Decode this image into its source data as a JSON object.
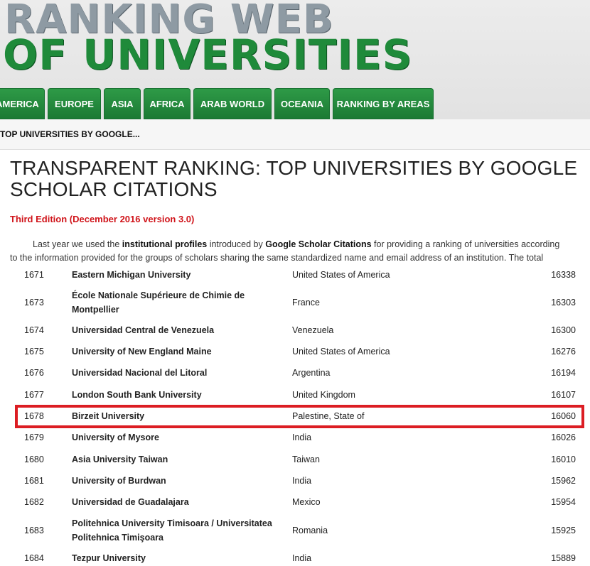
{
  "header": {
    "logo_line1": "RANKING WEB",
    "logo_line2": "OF UNIVERSITIES"
  },
  "nav": {
    "tabs": [
      {
        "label": "AMERICA"
      },
      {
        "label": "EUROPE"
      },
      {
        "label": "ASIA"
      },
      {
        "label": "AFRICA"
      },
      {
        "label": "ARAB WORLD"
      },
      {
        "label": "OCEANIA"
      },
      {
        "label": "RANKING BY AREAS"
      }
    ]
  },
  "breadcrumb": "TOP UNIVERSITIES BY GOOGLE...",
  "title": "TRANSPARENT RANKING: TOP UNIVERSITIES BY GOOGLE SCHOLAR CITATIONS",
  "edition": "Third Edition (December 2016 version 3.0)",
  "intro": {
    "p1": "Last year we used the ",
    "b1": "institutional profiles",
    "p2": " introduced by ",
    "b2": "Google Scholar Citations",
    "p3": " for providing a ranking of universities according",
    "line2": "to the information provided for the groups of scholars sharing the same standardized name and email address of an institution. The total"
  },
  "table": {
    "rows": [
      {
        "rank": "1671",
        "name": "Eastern Michigan University",
        "country": "United States of America",
        "citations": "16338"
      },
      {
        "rank": "1673",
        "name": "École Nationale Supérieure de Chimie de Montpellier",
        "country": "France",
        "citations": "16303"
      },
      {
        "rank": "1674",
        "name": "Universidad Central de Venezuela",
        "country": "Venezuela",
        "citations": "16300"
      },
      {
        "rank": "1675",
        "name": "University of New England Maine",
        "country": "United States of America",
        "citations": "16276"
      },
      {
        "rank": "1676",
        "name": "Universidad Nacional del Litoral",
        "country": "Argentina",
        "citations": "16194"
      },
      {
        "rank": "1677",
        "name": "London South Bank University",
        "country": "United Kingdom",
        "citations": "16107"
      },
      {
        "rank": "1678",
        "name": "Birzeit University",
        "country": "Palestine, State of",
        "citations": "16060"
      },
      {
        "rank": "1679",
        "name": "University of Mysore",
        "country": "India",
        "citations": "16026"
      },
      {
        "rank": "1680",
        "name": "Asia University Taiwan",
        "country": "Taiwan",
        "citations": "16010"
      },
      {
        "rank": "1681",
        "name": "University of Burdwan",
        "country": "India",
        "citations": "15962"
      },
      {
        "rank": "1682",
        "name": "Universidad de Guadalajara",
        "country": "Mexico",
        "citations": "15954"
      },
      {
        "rank": "1683",
        "name": "Politehnica University Timisoara / Universitatea Politehnica Timişoara",
        "country": "Romania",
        "citations": "15925"
      },
      {
        "rank": "1684",
        "name": "Tezpur University",
        "country": "India",
        "citations": "15889"
      }
    ]
  },
  "highlight_color": "#dc1d23"
}
